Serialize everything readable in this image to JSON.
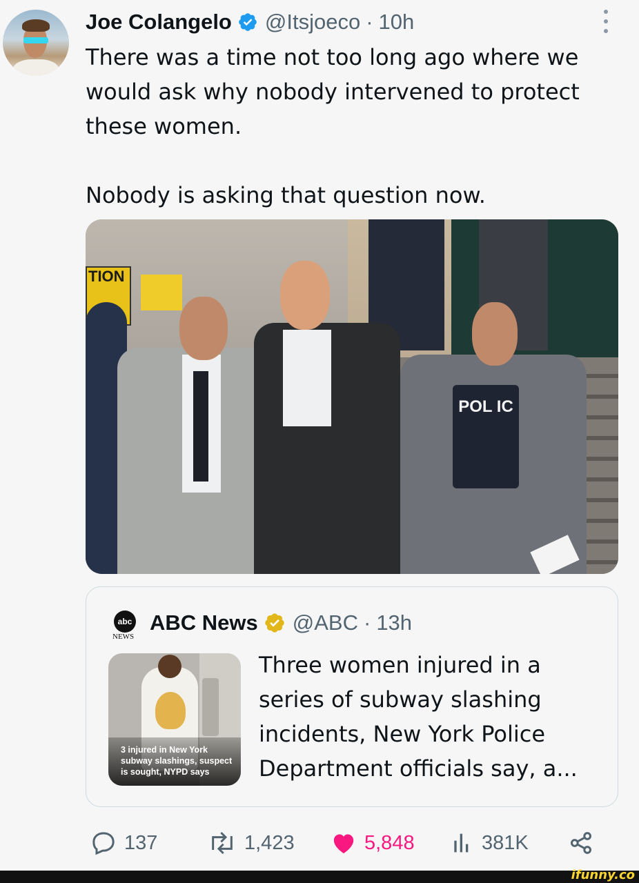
{
  "tweet": {
    "author_name": "Joe Colangelo",
    "handle": "@Itsjoeco",
    "separator": "·",
    "time": "10h",
    "paragraph1": "There was a time not too long ago where we would ask why nobody intervened to protect these women.",
    "paragraph2": "Nobody is asking that question now.",
    "photo": {
      "sign_text": "TION",
      "vest_text": "POL IC"
    }
  },
  "quoted": {
    "logo_text": "abc",
    "logo_sub": "NEWS",
    "author_name": "ABC News",
    "handle": "@ABC",
    "separator": "·",
    "time": "13h",
    "thumbnail_caption": "3 injured in New York subway slashings, suspect is sought, NYPD says",
    "text": "Three women injured in a series of subway slashing incidents, New York Police Department officials say, a..."
  },
  "actions": {
    "replies": "137",
    "retweets": "1,423",
    "likes": "5,848",
    "views": "381K"
  },
  "watermark": "ifunny.co",
  "colors": {
    "verified_blue": "#1d9bf0",
    "verified_gold": "#e2b719",
    "like_pink": "#f91880",
    "meta_gray": "#536471"
  }
}
